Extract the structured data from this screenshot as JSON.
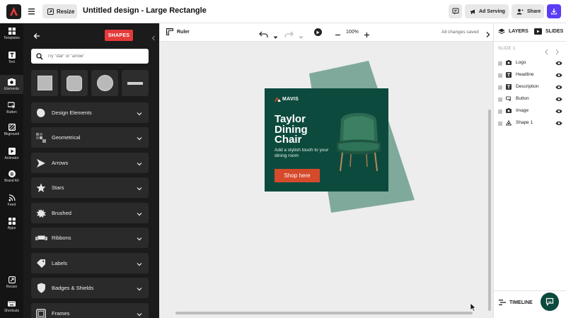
{
  "header": {
    "resize_label": "Resize",
    "title": "Untitled design - Large Rectangle",
    "ad_serving_label": "Ad Serving",
    "share_label": "Share"
  },
  "rail": {
    "items": [
      {
        "label": "Templates",
        "icon": "templates-icon"
      },
      {
        "label": "Text",
        "icon": "text-icon"
      },
      {
        "label": "Elements",
        "icon": "elements-icon"
      },
      {
        "label": "Button",
        "icon": "button-icon"
      },
      {
        "label": "Bkground",
        "icon": "background-icon"
      },
      {
        "label": "Animator",
        "icon": "animator-icon"
      },
      {
        "label": "Brand Kit",
        "icon": "brand-kit-icon"
      },
      {
        "label": "Feed",
        "icon": "feed-icon"
      },
      {
        "label": "Apps",
        "icon": "apps-icon"
      },
      {
        "label": "Resize",
        "icon": "resize-icon"
      },
      {
        "label": "Shortcuts",
        "icon": "keyboard-icon"
      }
    ]
  },
  "panel": {
    "badge": "SHAPES",
    "search_placeholder": "Try \"star\" or \"arrow\"",
    "categories": [
      {
        "label": "Design Elements"
      },
      {
        "label": "Geometrical"
      },
      {
        "label": "Arrows"
      },
      {
        "label": "Stars"
      },
      {
        "label": "Brushed"
      },
      {
        "label": "Ribbons"
      },
      {
        "label": "Labels"
      },
      {
        "label": "Badges & Shields"
      },
      {
        "label": "Frames"
      }
    ]
  },
  "canvas": {
    "ruler_label": "Ruler",
    "zoom": "100%",
    "save_status": "All changes saved"
  },
  "ad": {
    "logo_text": "MAVIS",
    "headline": "Taylor\nDining\nChair",
    "description": "Add a stylish touch to your dining room",
    "button_label": "Shop here",
    "colors": {
      "background": "#0d4a3e",
      "shape": "#7fa99b",
      "button": "#d64a2c"
    }
  },
  "right_panel": {
    "tabs": {
      "layers": "LAYERS",
      "slides": "SLIDES"
    },
    "slide_label": "SLIDE 1",
    "layers": [
      {
        "name": "Logo",
        "icon": "image-icon"
      },
      {
        "name": "Headline",
        "icon": "text-layer-icon"
      },
      {
        "name": "Description",
        "icon": "text-layer-icon"
      },
      {
        "name": "Button",
        "icon": "button-layer-icon"
      },
      {
        "name": "Image",
        "icon": "image-icon"
      },
      {
        "name": "Shape 1",
        "icon": "shape-layer-icon"
      }
    ],
    "timeline_label": "TIMELINE"
  }
}
